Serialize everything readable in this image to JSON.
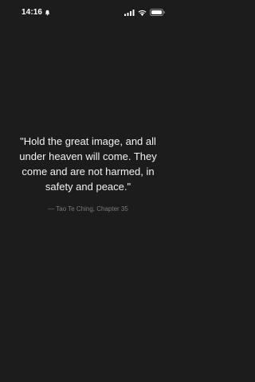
{
  "status_bar": {
    "time": "14:16",
    "icons": [
      "bell-icon",
      "cellular-signal-icon",
      "wifi-icon",
      "battery-icon"
    ]
  },
  "quote": {
    "text": "\"Hold the great image, and all under heaven will come. They come and are not harmed, in safety and peace.\"",
    "source": "— Tao Te Ching, Chapter 35"
  },
  "colors": {
    "background": "#1c1c1c",
    "quote_text": "#f2f2f2",
    "source_text": "#7a7a80"
  }
}
